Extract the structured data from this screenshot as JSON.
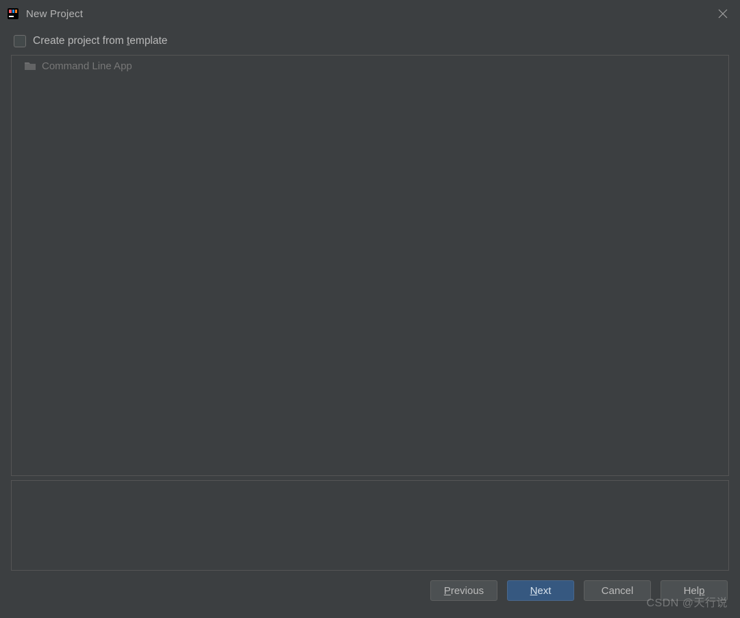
{
  "titlebar": {
    "title": "New Project"
  },
  "checkbox": {
    "label_pre": "Create project from ",
    "label_mn": "t",
    "label_post": "emplate"
  },
  "template_list": {
    "items": [
      {
        "label": "Command Line App"
      }
    ]
  },
  "buttons": {
    "previous_pre": "P",
    "previous_rest": "revious",
    "next_pre": "N",
    "next_rest": "ext",
    "cancel": "Cancel",
    "help_pre": "Hel",
    "help_mn": "p"
  },
  "watermark": "CSDN @天行说"
}
